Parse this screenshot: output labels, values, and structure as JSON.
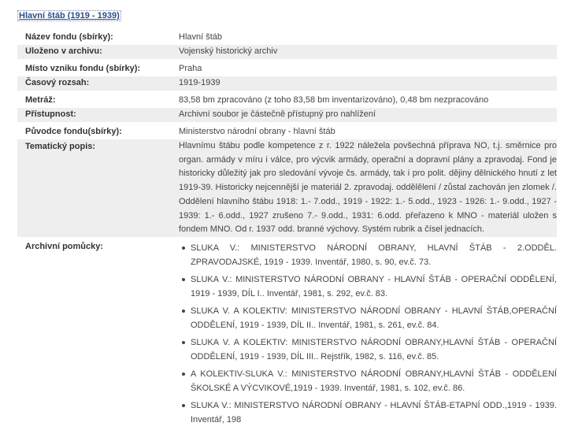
{
  "title_link": "Hlavní štáb (1919 - 1939)",
  "fields": {
    "nazev_fondu": {
      "label": "Název fondu (sbírky):",
      "value": "Hlavní štáb"
    },
    "ulozeno": {
      "label": "Uloženo v archivu:",
      "value": "Vojenský historický archiv"
    },
    "misto_vzniku": {
      "label": "Místo vzniku fondu (sbírky):",
      "value": "Praha"
    },
    "casovy_rozsah": {
      "label": "Časový rozsah:",
      "value": "1919-1939"
    },
    "metraz": {
      "label": "Metráž:",
      "value": "83,58 bm zpracováno (z toho 83,58 bm inventarizováno), 0,48 bm nezpracováno"
    },
    "pristupnost": {
      "label": "Přístupnost:",
      "value": "Archivní soubor je částečně přístupný pro nahlížení"
    },
    "puvodce": {
      "label": "Původce fondu(sbírky):",
      "value": "Ministerstvo národní obrany - hlavní štáb"
    },
    "tematicky_popis": {
      "label": "Tematický popis:",
      "value": "Hlavnímu štábu podle kompetence z r. 1922 náležela povšechná příprava NO, t.j. směrnice pro organ. armády v míru i válce, pro výcvik armády, operační a dopravní plány a zpravodaj. Fond je historicky důležitý jak pro sledování vývoje čs. armády, tak i pro polit. dějiny dělnického hnutí z let 1919-39. Historicky nejcennější je materiál 2. zpravodaj. oddělělení / zůstal zachován jen zlomek /. Oddělení hlavního štábu 1918: 1.- 7.odd., 1919 - 1922: 1.- 5.odd., 1923 - 1926: 1.- 9.odd., 1927 - 1939: 1.- 6.odd., 1927 zrušeno 7.- 9.odd., 1931: 6.odd. přeřazeno k MNO - materiál uložen s fondem MNO. Od r. 1937 odd. branné výchovy. Systém rubrik a čísel jednacích."
    },
    "archivni_pomucky": {
      "label": "Archivní pomůcky:",
      "items": [
        "SLUKA V.: MINISTERSTVO NÁRODNÍ OBRANY, HLAVNÍ ŠTÁB - 2.ODDĚL. ZPRAVODAJSKÉ, 1919 - 1939. Inventář, 1980, s. 90, ev.č. 73.",
        "SLUKA V.: MINISTERSTVO NÁRODNÍ OBRANY - HLAVNÍ ŠTÁB - OPERAČNÍ ODDĚLENÍ, 1919 - 1939, DÍL I.. Inventář, 1981, s. 292, ev.č. 83.",
        "SLUKA V. A KOLEKTIV: MINISTERSTVO NÁRODNÍ OBRANY - HLAVNÍ ŠTÁB,OPERAČNÍ ODDĚLENÍ, 1919 - 1939, DÍL II.. Inventář, 1981, s. 261, ev.č. 84.",
        "SLUKA V. A KOLEKTIV: MINISTERSTVO NÁRODNÍ OBRANY,HLAVNÍ ŠTÁB - OPERAČNÍ ODDĚLENÍ, 1919 - 1939, DÍL III.. Rejstřík, 1982, s. 116, ev.č. 85.",
        "A KOLEKTIV-SLUKA V.: MINISTERSTVO NÁRODNÍ OBRANY,HLAVNÍ ŠTÁB - ODDĚLENÍ ŠKOLSKÉ A VÝCVIKOVÉ,1919 - 1939. Inventář, 1981, s. 102, ev.č. 86.",
        "SLUKA V.: MINISTERSTVO NÁRODNÍ OBRANY - HLAVNÍ ŠTÁB-ETAPNÍ ODD.,1919 - 1939. Inventář, 198"
      ]
    }
  }
}
